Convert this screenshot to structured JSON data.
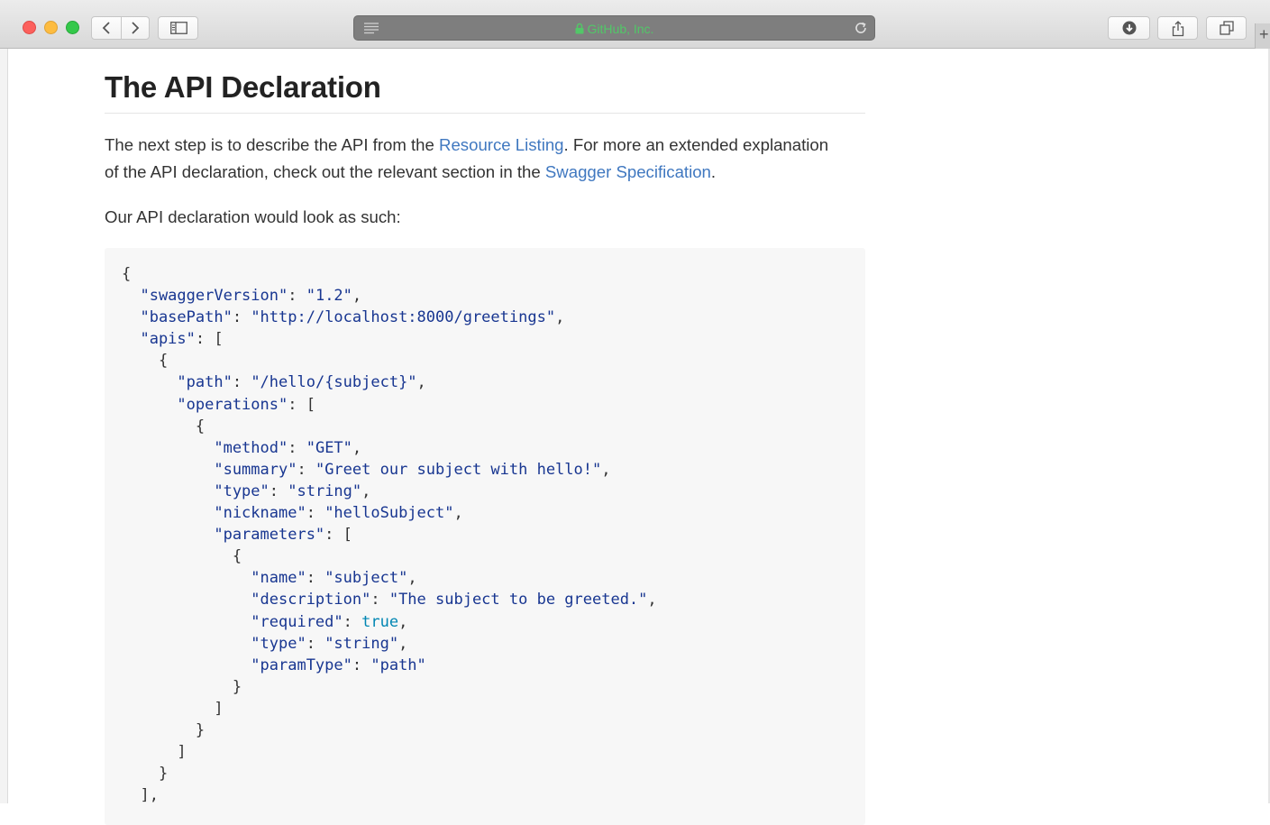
{
  "browser": {
    "address_title": "GitHub, Inc."
  },
  "article": {
    "heading": "The API Declaration",
    "p1": {
      "t1": "The next step is to describe the API from the ",
      "link1": "Resource Listing",
      "t2": ". For more an extended explanation",
      "t3": "of the API declaration, check out the relevant section in the ",
      "link2": "Swagger Specification",
      "t4": "."
    },
    "p2": "Our API declaration would look as such:"
  },
  "code": {
    "l1": "{",
    "l2k": "  \"swaggerVersion\"",
    "l2v": "\"1.2\"",
    "l3k": "  \"basePath\"",
    "l3v": "\"http://localhost:8000/greetings\"",
    "l4k": "  \"apis\"",
    "l4r": ": [",
    "l5": "    {",
    "l6k": "      \"path\"",
    "l6v": "\"/hello/{subject}\"",
    "l7k": "      \"operations\"",
    "l7r": ": [",
    "l8": "        {",
    "l9k": "          \"method\"",
    "l9v": "\"GET\"",
    "l10k": "          \"summary\"",
    "l10v": "\"Greet our subject with hello!\"",
    "l11k": "          \"type\"",
    "l11v": "\"string\"",
    "l12k": "          \"nickname\"",
    "l12v": "\"helloSubject\"",
    "l13k": "          \"parameters\"",
    "l13r": ": [",
    "l14": "            {",
    "l15k": "              \"name\"",
    "l15v": "\"subject\"",
    "l16k": "              \"description\"",
    "l16v": "\"The subject to be greeted.\"",
    "l17k": "              \"required\"",
    "l17v": "true",
    "l18k": "              \"type\"",
    "l18v": "\"string\"",
    "l19k": "              \"paramType\"",
    "l19v": "\"path\"",
    "l20": "            }",
    "l21": "          ]",
    "l22": "        }",
    "l23": "      ]",
    "l24": "    }",
    "l25": "  ],"
  }
}
